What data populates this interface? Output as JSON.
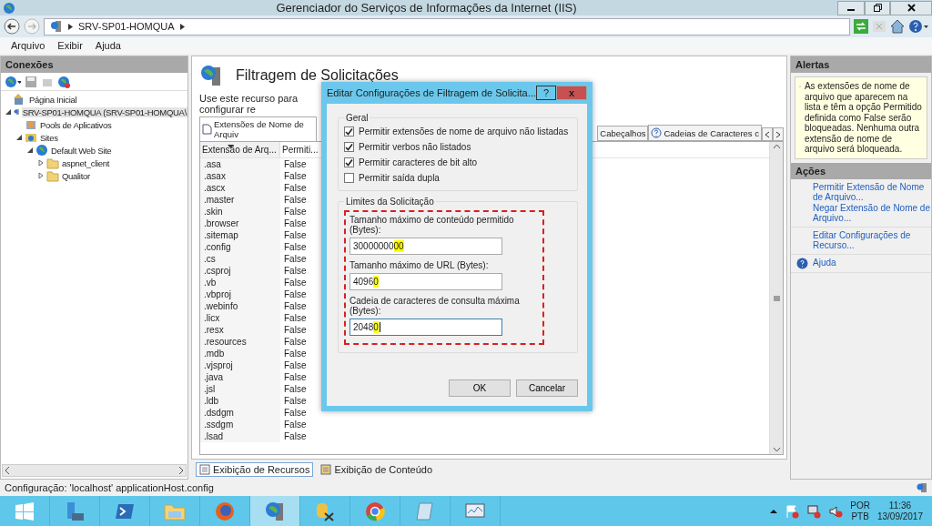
{
  "window": {
    "title": "Gerenciador do Serviços de Informações da Internet (IIS)"
  },
  "address_bar": {
    "segments": [
      "SRV-SP01-HOMQUA"
    ]
  },
  "menu": [
    "Arquivo",
    "Exibir",
    "Ajuda"
  ],
  "connections": {
    "title": "Conexões",
    "tree": [
      {
        "label": "Página Inicial",
        "kind": "home",
        "selected": false
      },
      {
        "label": "SRV-SP01-HOMQUA (SRV-SP01-HOMQUA\\",
        "kind": "server",
        "selected": true,
        "expanded": true,
        "children": [
          {
            "label": "Pools de Aplicativos",
            "kind": "pool",
            "selected": false
          },
          {
            "label": "Sites",
            "kind": "sites",
            "selected": false,
            "expanded": true,
            "children": [
              {
                "label": "Default Web Site",
                "kind": "globe",
                "selected": false,
                "expanded": true,
                "children": [
                  {
                    "label": "aspnet_client",
                    "kind": "folder",
                    "selected": false,
                    "expanded": false
                  },
                  {
                    "label": "Qualitor",
                    "kind": "folder",
                    "selected": false,
                    "expanded": false
                  }
                ]
              }
            ]
          }
        ]
      }
    ]
  },
  "feature": {
    "title": "Filtragem de Solicitações",
    "description": "Use este recurso para configurar re",
    "tabs_left": [
      {
        "label": "Extensões de Nome de Arquiv",
        "selected": true
      }
    ],
    "tabs_right": [
      {
        "label": "Cabeçalhos",
        "selected": false
      },
      {
        "label": "Cadeias de Caracteres c",
        "selected": false
      }
    ],
    "columns": [
      {
        "label": "Extensão de Arq...",
        "sorted": true
      },
      {
        "label": "Permiti...",
        "sorted": false
      }
    ],
    "rows": [
      [
        ".asa",
        "False"
      ],
      [
        ".asax",
        "False"
      ],
      [
        ".ascx",
        "False"
      ],
      [
        ".master",
        "False"
      ],
      [
        ".skin",
        "False"
      ],
      [
        ".browser",
        "False"
      ],
      [
        ".sitemap",
        "False"
      ],
      [
        ".config",
        "False"
      ],
      [
        ".cs",
        "False"
      ],
      [
        ".csproj",
        "False"
      ],
      [
        ".vb",
        "False"
      ],
      [
        ".vbproj",
        "False"
      ],
      [
        ".webinfo",
        "False"
      ],
      [
        ".licx",
        "False"
      ],
      [
        ".resx",
        "False"
      ],
      [
        ".resources",
        "False"
      ],
      [
        ".mdb",
        "False"
      ],
      [
        ".vjsproj",
        "False"
      ],
      [
        ".java",
        "False"
      ],
      [
        ".jsl",
        "False"
      ],
      [
        ".ldb",
        "False"
      ],
      [
        ".dsdgm",
        "False"
      ],
      [
        ".ssdgm",
        "False"
      ],
      [
        ".lsad",
        "False"
      ]
    ],
    "views": [
      {
        "label": "Exibição de Recursos",
        "selected": true
      },
      {
        "label": "Exibição de Conteúdo",
        "selected": false
      }
    ]
  },
  "dialog": {
    "title": "Editar Configurações de Filtragem de Solicita...",
    "help": "?",
    "close": "x",
    "general": {
      "title": "Geral",
      "options": [
        {
          "label": "Permitir extensões de nome de arquivo não listadas",
          "checked": true
        },
        {
          "label": "Permitir verbos não listados",
          "checked": true
        },
        {
          "label": "Permitir caracteres de bit alto",
          "checked": true
        },
        {
          "label": "Permitir saída dupla",
          "checked": false
        }
      ]
    },
    "limits": {
      "title": "Limites da Solicitação",
      "marked": true,
      "fields": [
        {
          "label": "Tamanho máximo de conteúdo permitido (Bytes):",
          "value_plain": "30000000",
          "value_highlighted": "00",
          "focused": false
        },
        {
          "label": "Tamanho máximo de URL (Bytes):",
          "value_plain": "4096",
          "value_highlighted": "0",
          "focused": false
        },
        {
          "label": "Cadeia de caracteres de consulta máxima (Bytes):",
          "value_plain": "2048",
          "value_highlighted": "0",
          "focused": true
        }
      ]
    },
    "buttons": [
      "OK",
      "Cancelar"
    ]
  },
  "alerts": {
    "title": "Alertas",
    "message": "As extensões de nome de arquivo que aparecem na lista e têm a opção Permitido definida como False serão bloqueadas. Nenhuma outra extensão de nome de arquivo será bloqueada."
  },
  "actions": {
    "title": "Ações",
    "groups": [
      [
        {
          "label": "Permitir Extensão de Nome de Arquivo...",
          "kind": "link"
        },
        {
          "label": "Negar Extensão de Nome de Arquivo...",
          "kind": "link"
        }
      ],
      [
        {
          "label": "Editar Configurações de Recurso...",
          "kind": "link"
        }
      ],
      [
        {
          "label": "Ajuda",
          "kind": "help"
        }
      ]
    ]
  },
  "status_bar": {
    "text": "Configuração: 'localhost' applicationHost.config"
  },
  "taskbar": {
    "apps": [
      {
        "kind": "start",
        "selected": false
      },
      {
        "kind": "server",
        "selected": false
      },
      {
        "kind": "shell",
        "selected": false
      },
      {
        "kind": "folder",
        "selected": false
      },
      {
        "kind": "firefox",
        "selected": false
      },
      {
        "kind": "iis",
        "selected": true
      },
      {
        "kind": "dbtools",
        "selected": false
      },
      {
        "kind": "chrome",
        "selected": false
      },
      {
        "kind": "notepad",
        "selected": false
      },
      {
        "kind": "monitor",
        "selected": false
      }
    ],
    "language": "POR",
    "layout": "PTB",
    "time": "11:36",
    "date": "13/09/2017"
  }
}
